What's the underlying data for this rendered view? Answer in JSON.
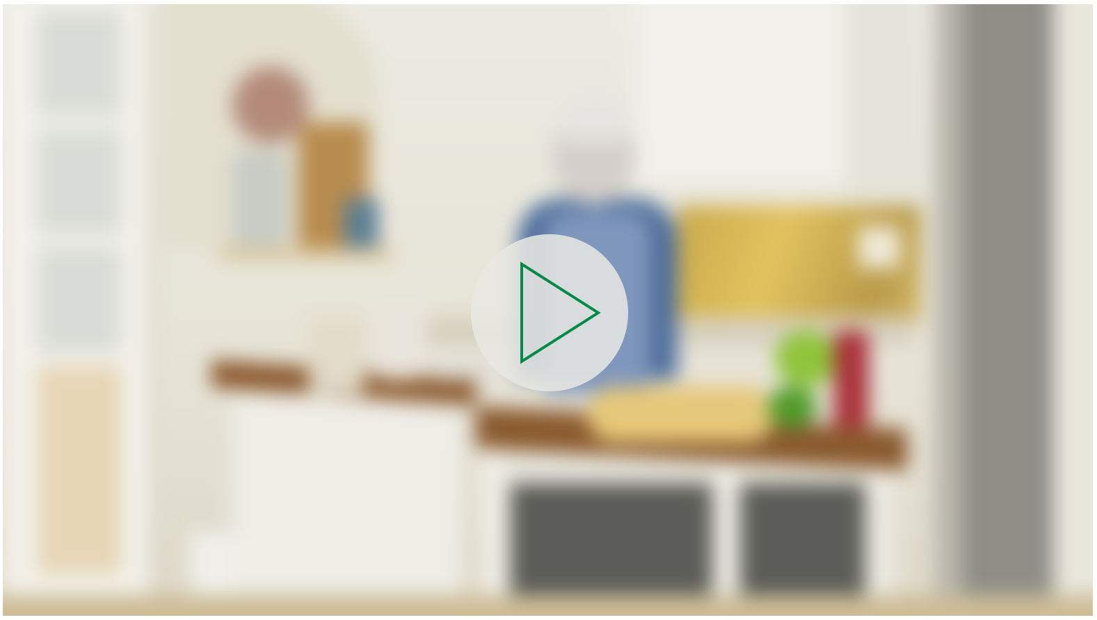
{
  "video": {
    "state": "paused",
    "play_button_icon": "play-icon"
  },
  "colors": {
    "play_icon_stroke": "#008a47",
    "play_button_fill": "#e8e8e2"
  }
}
